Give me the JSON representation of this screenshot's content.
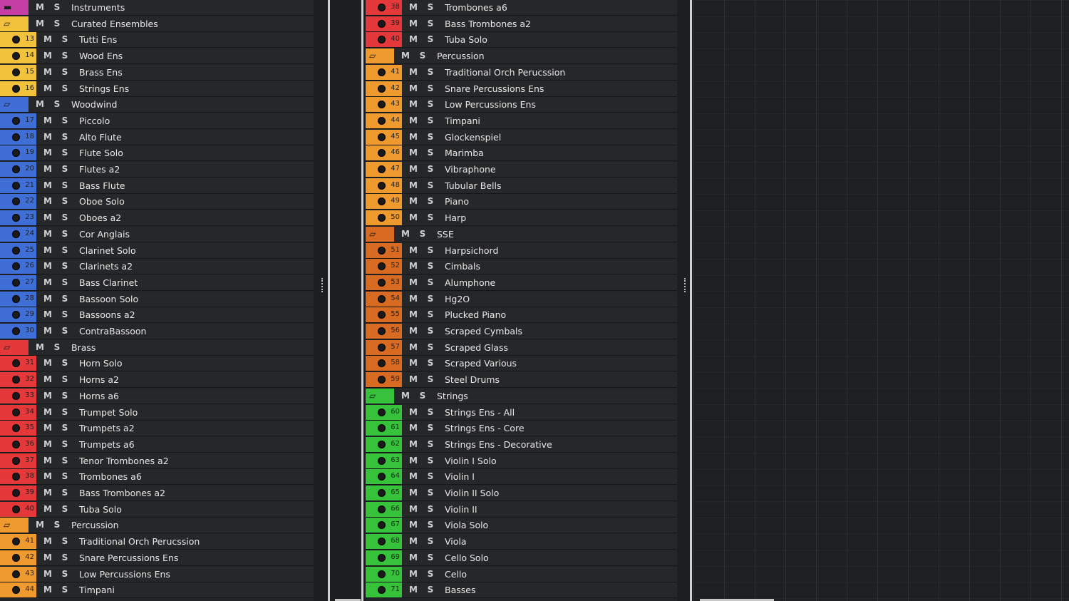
{
  "colors": {
    "purple": "#c43ea5",
    "yellow": "#f2c23c",
    "blue": "#3f6ed6",
    "red": "#e5383b",
    "orange": "#ef9a2f",
    "brown": "#d86a22",
    "green": "#36c23a"
  },
  "mute_label": "M",
  "solo_label": "S",
  "left_panel": [
    {
      "type": "folder",
      "name": "Instruments",
      "color": "#c43ea5",
      "icon": "folder-closed-icon"
    },
    {
      "type": "folder",
      "name": "Curated Ensembles",
      "color": "#f2c23c",
      "icon": "folder-open-icon"
    },
    {
      "type": "track",
      "num": "13",
      "name": "Tutti Ens",
      "color": "#f2c23c"
    },
    {
      "type": "track",
      "num": "14",
      "name": "Wood Ens",
      "color": "#f2c23c"
    },
    {
      "type": "track",
      "num": "15",
      "name": "Brass Ens",
      "color": "#f2c23c"
    },
    {
      "type": "track",
      "num": "16",
      "name": "Strings Ens",
      "color": "#f2c23c"
    },
    {
      "type": "folder",
      "name": "Woodwind",
      "color": "#3f6ed6",
      "icon": "folder-open-icon"
    },
    {
      "type": "track",
      "num": "17",
      "name": "Piccolo",
      "color": "#3f6ed6"
    },
    {
      "type": "track",
      "num": "18",
      "name": "Alto Flute",
      "color": "#3f6ed6"
    },
    {
      "type": "track",
      "num": "19",
      "name": "Flute Solo",
      "color": "#3f6ed6"
    },
    {
      "type": "track",
      "num": "20",
      "name": "Flutes a2",
      "color": "#3f6ed6"
    },
    {
      "type": "track",
      "num": "21",
      "name": "Bass Flute",
      "color": "#3f6ed6"
    },
    {
      "type": "track",
      "num": "22",
      "name": "Oboe Solo",
      "color": "#3f6ed6"
    },
    {
      "type": "track",
      "num": "23",
      "name": "Oboes a2",
      "color": "#3f6ed6"
    },
    {
      "type": "track",
      "num": "24",
      "name": "Cor Anglais",
      "color": "#3f6ed6"
    },
    {
      "type": "track",
      "num": "25",
      "name": "Clarinet Solo",
      "color": "#3f6ed6"
    },
    {
      "type": "track",
      "num": "26",
      "name": "Clarinets a2",
      "color": "#3f6ed6"
    },
    {
      "type": "track",
      "num": "27",
      "name": "Bass Clarinet",
      "color": "#3f6ed6"
    },
    {
      "type": "track",
      "num": "28",
      "name": "Bassoon Solo",
      "color": "#3f6ed6"
    },
    {
      "type": "track",
      "num": "29",
      "name": "Bassoons a2",
      "color": "#3f6ed6"
    },
    {
      "type": "track",
      "num": "30",
      "name": "ContraBassoon",
      "color": "#3f6ed6"
    },
    {
      "type": "folder",
      "name": "Brass",
      "color": "#e5383b",
      "icon": "folder-open-icon"
    },
    {
      "type": "track",
      "num": "31",
      "name": "Horn Solo",
      "color": "#e5383b"
    },
    {
      "type": "track",
      "num": "32",
      "name": "Horns a2",
      "color": "#e5383b"
    },
    {
      "type": "track",
      "num": "33",
      "name": "Horns a6",
      "color": "#e5383b"
    },
    {
      "type": "track",
      "num": "34",
      "name": "Trumpet Solo",
      "color": "#e5383b"
    },
    {
      "type": "track",
      "num": "35",
      "name": "Trumpets a2",
      "color": "#e5383b"
    },
    {
      "type": "track",
      "num": "36",
      "name": "Trumpets a6",
      "color": "#e5383b"
    },
    {
      "type": "track",
      "num": "37",
      "name": "Tenor Trombones a2",
      "color": "#e5383b"
    },
    {
      "type": "track",
      "num": "38",
      "name": "Trombones a6",
      "color": "#e5383b"
    },
    {
      "type": "track",
      "num": "39",
      "name": "Bass Trombones a2",
      "color": "#e5383b"
    },
    {
      "type": "track",
      "num": "40",
      "name": "Tuba Solo",
      "color": "#e5383b"
    },
    {
      "type": "folder",
      "name": "Percussion",
      "color": "#ef9a2f",
      "icon": "folder-open-icon"
    },
    {
      "type": "track",
      "num": "41",
      "name": "Traditional Orch Perucssion",
      "color": "#ef9a2f"
    },
    {
      "type": "track",
      "num": "42",
      "name": "Snare Percussions Ens",
      "color": "#ef9a2f"
    },
    {
      "type": "track",
      "num": "43",
      "name": "Low Percussions Ens",
      "color": "#ef9a2f"
    },
    {
      "type": "track",
      "num": "44",
      "name": "Timpani",
      "color": "#ef9a2f"
    }
  ],
  "mid_panel": [
    {
      "type": "track",
      "num": "38",
      "name": "Trombones a6",
      "color": "#e5383b"
    },
    {
      "type": "track",
      "num": "39",
      "name": "Bass Trombones a2",
      "color": "#e5383b"
    },
    {
      "type": "track",
      "num": "40",
      "name": "Tuba Solo",
      "color": "#e5383b"
    },
    {
      "type": "folder",
      "name": "Percussion",
      "color": "#ef9a2f",
      "icon": "folder-open-icon"
    },
    {
      "type": "track",
      "num": "41",
      "name": "Traditional Orch Perucssion",
      "color": "#ef9a2f"
    },
    {
      "type": "track",
      "num": "42",
      "name": "Snare Percussions Ens",
      "color": "#ef9a2f"
    },
    {
      "type": "track",
      "num": "43",
      "name": "Low Percussions Ens",
      "color": "#ef9a2f"
    },
    {
      "type": "track",
      "num": "44",
      "name": "Timpani",
      "color": "#ef9a2f"
    },
    {
      "type": "track",
      "num": "45",
      "name": "Glockenspiel",
      "color": "#ef9a2f"
    },
    {
      "type": "track",
      "num": "46",
      "name": "Marimba",
      "color": "#ef9a2f"
    },
    {
      "type": "track",
      "num": "47",
      "name": "Vibraphone",
      "color": "#ef9a2f"
    },
    {
      "type": "track",
      "num": "48",
      "name": "Tubular Bells",
      "color": "#ef9a2f"
    },
    {
      "type": "track",
      "num": "49",
      "name": "Piano",
      "color": "#ef9a2f"
    },
    {
      "type": "track",
      "num": "50",
      "name": "Harp",
      "color": "#ef9a2f"
    },
    {
      "type": "folder",
      "name": "SSE",
      "color": "#d86a22",
      "icon": "folder-open-icon"
    },
    {
      "type": "track",
      "num": "51",
      "name": "Harpsichord",
      "color": "#d86a22"
    },
    {
      "type": "track",
      "num": "52",
      "name": "Cimbals",
      "color": "#d86a22"
    },
    {
      "type": "track",
      "num": "53",
      "name": "Alumphone",
      "color": "#d86a22"
    },
    {
      "type": "track",
      "num": "54",
      "name": "Hg2O",
      "color": "#d86a22"
    },
    {
      "type": "track",
      "num": "55",
      "name": "Plucked Piano",
      "color": "#d86a22"
    },
    {
      "type": "track",
      "num": "56",
      "name": "Scraped Cymbals",
      "color": "#d86a22"
    },
    {
      "type": "track",
      "num": "57",
      "name": "Scraped Glass",
      "color": "#d86a22"
    },
    {
      "type": "track",
      "num": "58",
      "name": "Scraped Various",
      "color": "#d86a22"
    },
    {
      "type": "track",
      "num": "59",
      "name": "Steel Drums",
      "color": "#d86a22"
    },
    {
      "type": "folder",
      "name": "Strings",
      "color": "#36c23a",
      "icon": "folder-open-icon"
    },
    {
      "type": "track",
      "num": "60",
      "name": "Strings Ens - All",
      "color": "#36c23a"
    },
    {
      "type": "track",
      "num": "61",
      "name": "Strings Ens - Core",
      "color": "#36c23a"
    },
    {
      "type": "track",
      "num": "62",
      "name": "Strings Ens - Decorative",
      "color": "#36c23a"
    },
    {
      "type": "track",
      "num": "63",
      "name": "Violin I Solo",
      "color": "#36c23a"
    },
    {
      "type": "track",
      "num": "64",
      "name": "Violin I",
      "color": "#36c23a"
    },
    {
      "type": "track",
      "num": "65",
      "name": "Violin II Solo",
      "color": "#36c23a"
    },
    {
      "type": "track",
      "num": "66",
      "name": "Violin II",
      "color": "#36c23a"
    },
    {
      "type": "track",
      "num": "67",
      "name": "Viola Solo",
      "color": "#36c23a"
    },
    {
      "type": "track",
      "num": "68",
      "name": "Viola",
      "color": "#36c23a"
    },
    {
      "type": "track",
      "num": "69",
      "name": "Cello Solo",
      "color": "#36c23a"
    },
    {
      "type": "track",
      "num": "70",
      "name": "Cello",
      "color": "#36c23a"
    },
    {
      "type": "track",
      "num": "71",
      "name": "Basses",
      "color": "#36c23a"
    }
  ]
}
